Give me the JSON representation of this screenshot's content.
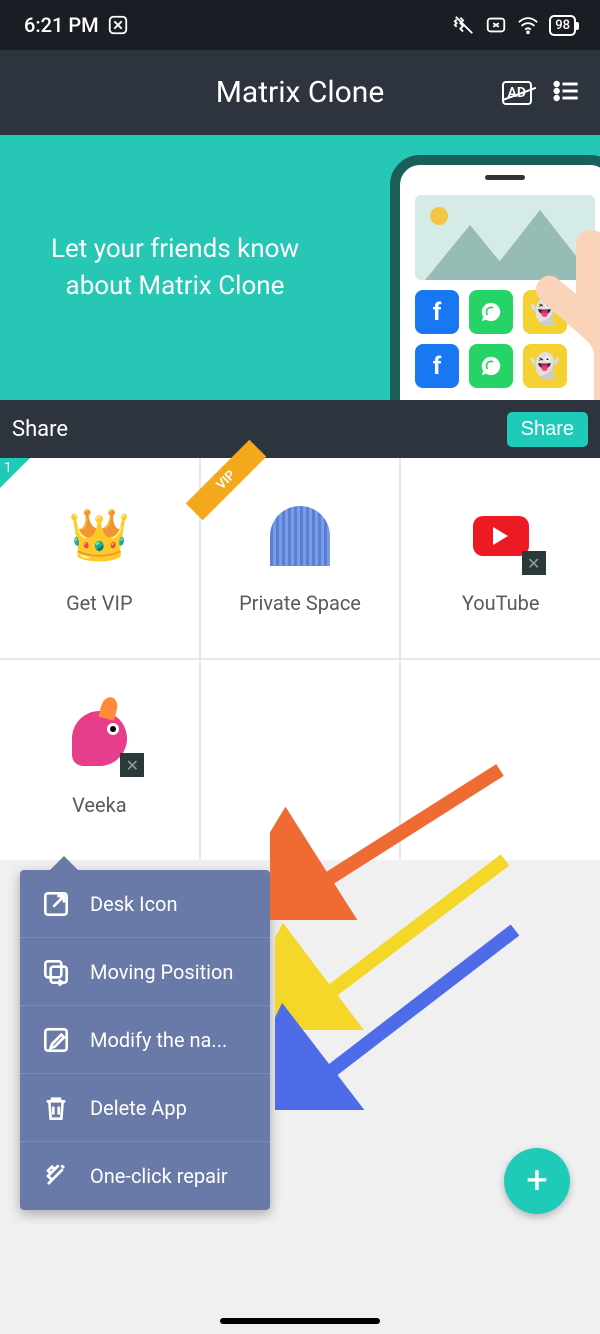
{
  "status": {
    "time": "6:21 PM",
    "battery": "98"
  },
  "header": {
    "title": "Matrix Clone",
    "ad_label": "AD"
  },
  "banner": {
    "line1": "Let your friends know",
    "line2": "about Matrix Clone"
  },
  "shareBar": {
    "label": "Share",
    "button": "Share"
  },
  "tiles": {
    "badge": "1",
    "vip_ribbon": "VIP",
    "getvip": "Get VIP",
    "private": "Private Space",
    "youtube": "YouTube",
    "veeka": "Veeka"
  },
  "popup": {
    "desk": "Desk Icon",
    "move": "Moving Position",
    "rename": "Modify the na...",
    "delete": "Delete App",
    "repair": "One-click repair"
  }
}
